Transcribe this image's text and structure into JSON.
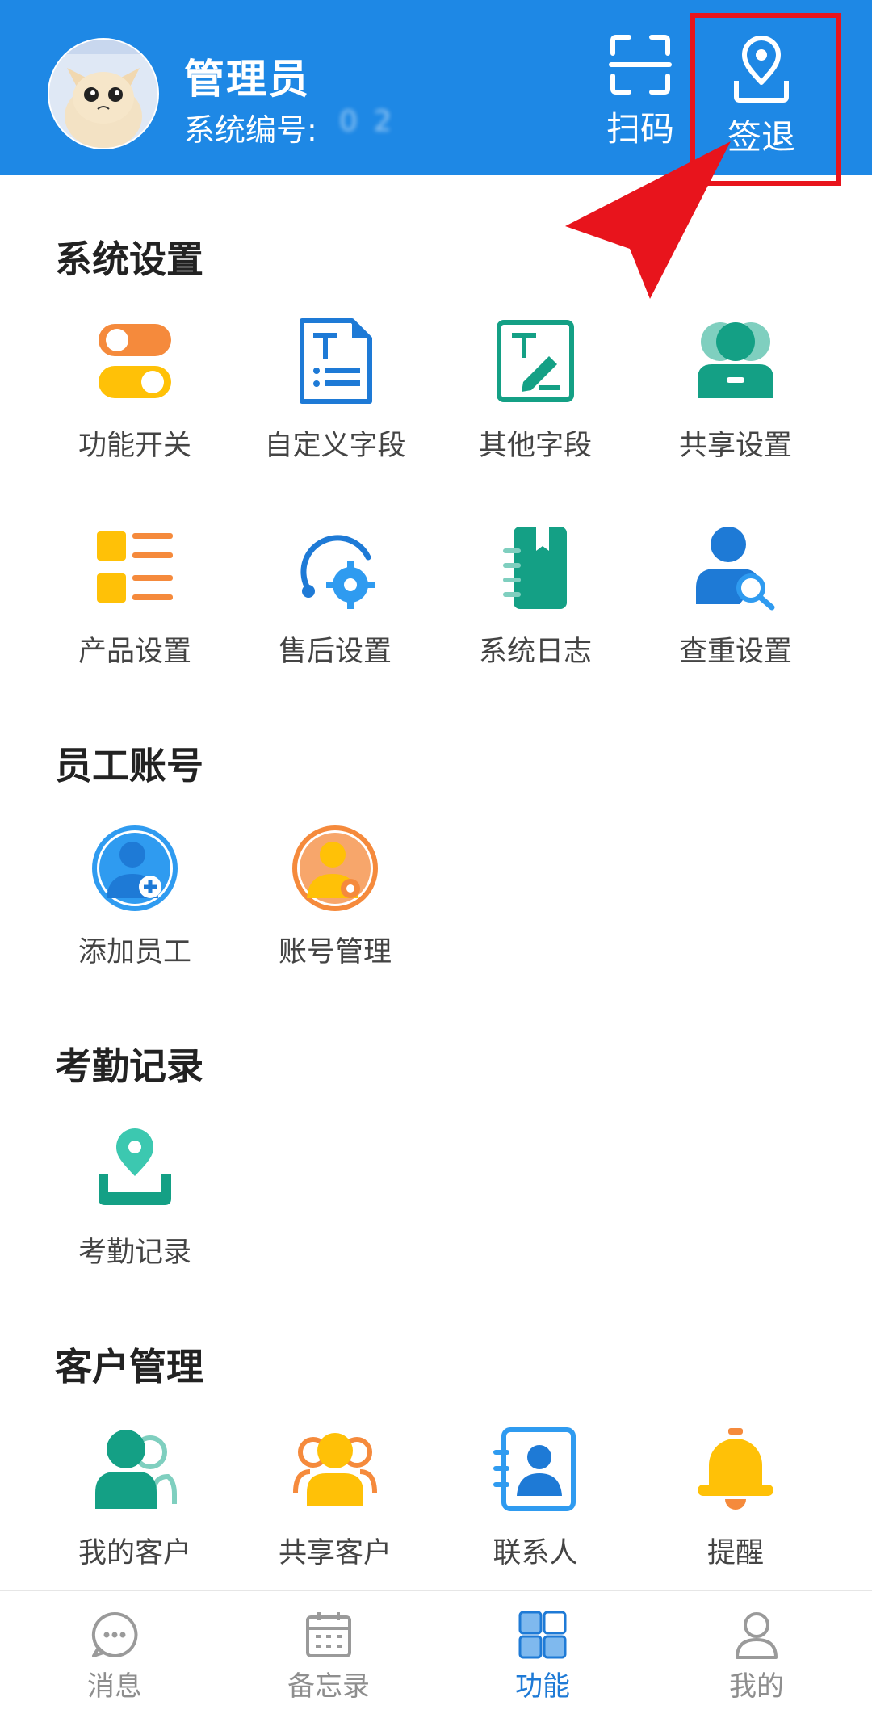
{
  "header": {
    "user_name": "管理员",
    "user_id_label": "系统编号:",
    "user_id_value": "0        2",
    "scan_label": "扫码",
    "checkout_label": "签退"
  },
  "sections": [
    {
      "title": "系统设置",
      "items": [
        {
          "label": "功能开关",
          "icon": "toggle-switch-icon"
        },
        {
          "label": "自定义字段",
          "icon": "custom-field-document-icon"
        },
        {
          "label": "其他字段",
          "icon": "edit-text-field-icon"
        },
        {
          "label": "共享设置",
          "icon": "shared-users-icon"
        },
        {
          "label": "产品设置",
          "icon": "product-list-icon"
        },
        {
          "label": "售后设置",
          "icon": "after-sales-gear-icon"
        },
        {
          "label": "系统日志",
          "icon": "system-log-notebook-icon"
        },
        {
          "label": "查重设置",
          "icon": "user-search-icon"
        }
      ]
    },
    {
      "title": "员工账号",
      "items": [
        {
          "label": "添加员工",
          "icon": "add-employee-icon"
        },
        {
          "label": "账号管理",
          "icon": "account-settings-icon"
        }
      ]
    },
    {
      "title": "考勤记录",
      "items": [
        {
          "label": "考勤记录",
          "icon": "attendance-location-icon"
        }
      ]
    },
    {
      "title": "客户管理",
      "items": [
        {
          "label": "我的客户",
          "icon": "my-customer-icon"
        },
        {
          "label": "共享客户",
          "icon": "shared-customer-icon"
        },
        {
          "label": "联系人",
          "icon": "contact-card-icon"
        },
        {
          "label": "提醒",
          "icon": "reminder-bell-icon"
        }
      ]
    }
  ],
  "bottom_nav": [
    {
      "label": "消息",
      "icon": "message-bubble-icon",
      "active": false
    },
    {
      "label": "备忘录",
      "icon": "calendar-memo-icon",
      "active": false
    },
    {
      "label": "功能",
      "icon": "grid-functions-icon",
      "active": true
    },
    {
      "label": "我的",
      "icon": "profile-person-icon",
      "active": false
    }
  ],
  "colors": {
    "header_bg": "#1e88e5",
    "highlight": "#e8141c",
    "active_nav": "#1e7ad6"
  }
}
